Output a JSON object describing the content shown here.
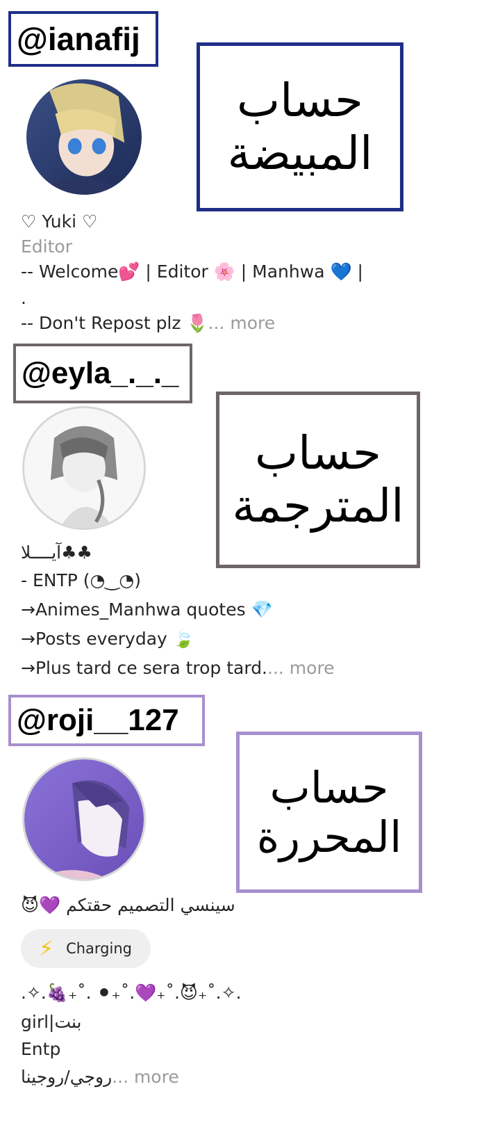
{
  "accounts": [
    {
      "handle": "@ianafij",
      "label_line1": "حساب",
      "label_line2": "المبيضة",
      "accent": "#1f2e87",
      "name": "♡ Yuki ♡",
      "category": "Editor",
      "bio": [
        "-- Welcome💕 |  Editor 🌸 | Manhwa 💙 |",
        ".",
        "-- Don't Repost plz 🌷"
      ],
      "more": "... more"
    },
    {
      "handle": "@eyla_._._",
      "label_line1": "حساب",
      "label_line2": "المترجمة",
      "accent": "#6e6666",
      "name": "♣♣آيــــلا",
      "bio": [
        "- ENTP (◔‿◔)",
        "→Animes_Manhwa quotes 💎",
        "→Posts everyday 🍃",
        "→Plus tard ce sera trop tard."
      ],
      "more": "... more"
    },
    {
      "handle": "@roji__127",
      "label_line1": "حساب",
      "label_line2": "المحررة",
      "accent": "#a78fcf",
      "name": "سينسي التصميم حقتكم 💜😈",
      "charging_label": "Charging",
      "bio": [
        ".✧.🍇₊˚. ⚫₊˚.💜₊˚.😈₊˚.✧.",
        "بنت|girl",
        "Entp",
        "روجي/روجينا"
      ],
      "more": "... more"
    }
  ],
  "icons": {
    "charging": "lightning-bolt-icon"
  }
}
